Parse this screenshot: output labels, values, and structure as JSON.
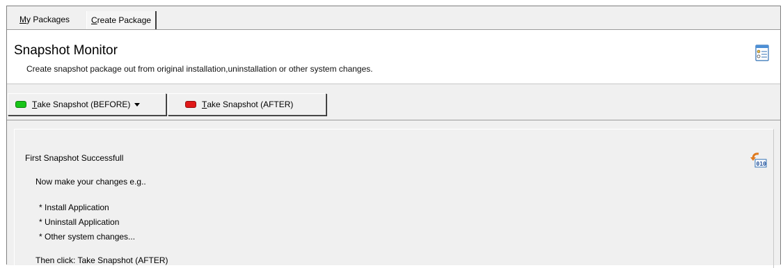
{
  "tabs": {
    "my_packages_prefix": "M",
    "my_packages_rest": "y Packages",
    "create_package_prefix": "C",
    "create_package_rest": "reate Package"
  },
  "header": {
    "title": "Snapshot Monitor",
    "subtitle": "Create snapshot package out from original installation,uninstallation or other system changes.",
    "icon": "settings-window-icon"
  },
  "toolbar": {
    "before_prefix": "T",
    "before_rest": "ake Snapshot (BEFORE)",
    "before_led_color": "#17c417",
    "after_prefix": "T",
    "after_rest": "ake Snapshot (AFTER)",
    "after_led_color": "#e01818"
  },
  "content": {
    "status": "First Snapshot Successfull",
    "instruction": "Now make your changes e.g..",
    "items": [
      "* Install Application",
      "* Uninstall Application",
      "* Other system changes..."
    ],
    "final": "Then click: Take Snapshot (AFTER)",
    "icon": "undo-binary-icon"
  }
}
